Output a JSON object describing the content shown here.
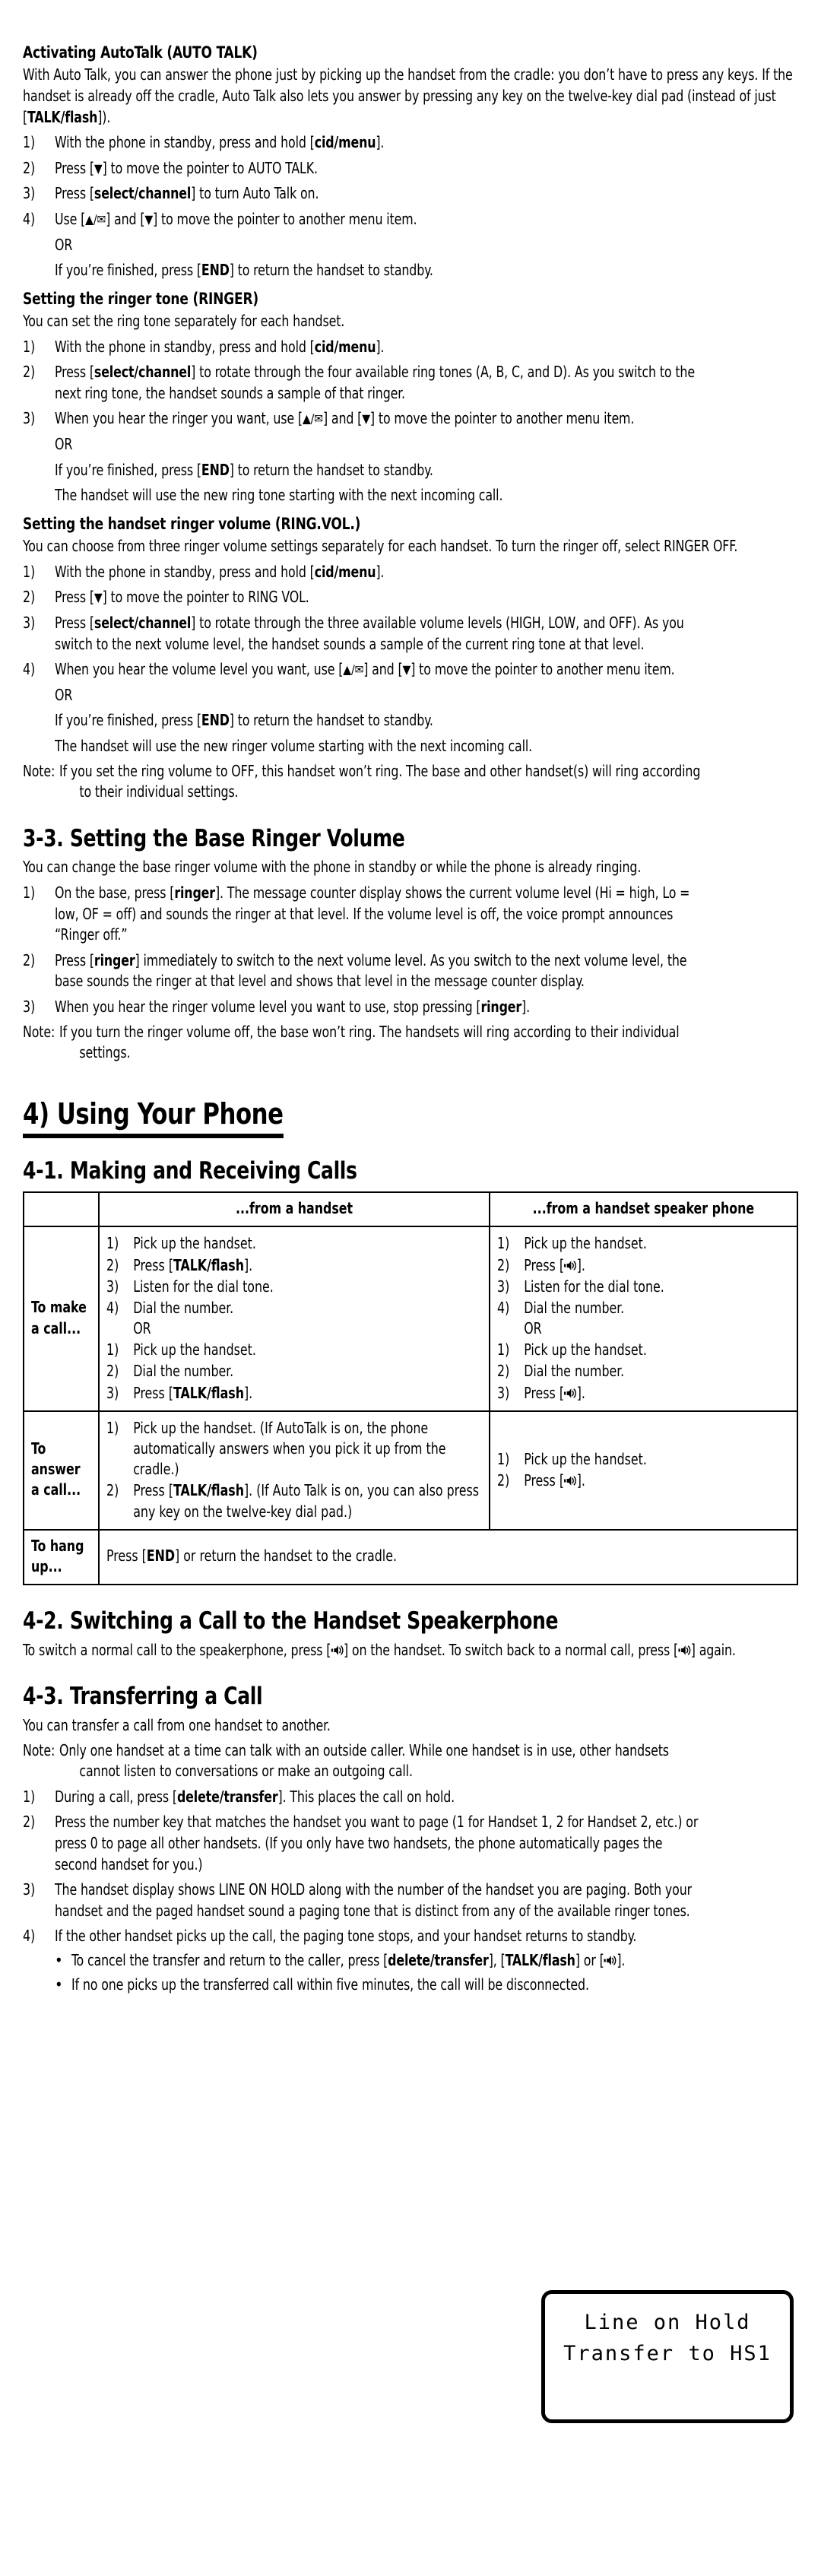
{
  "sections": [
    {
      "id": "autotalk",
      "heading": "Activating AutoTalk (AUTO TALK)",
      "intro": "With Auto Talk, you can answer the phone just by picking up the handset from the cradle: you don’t have to press any keys. If the handset is already off the cradle,  Auto Talk also lets you answer by pressing any key on the twelve-key dial pad (instead of just [TALK/flash]).",
      "steps": [
        {
          "num": "1)",
          "text": "With the phone in standby, press and hold [cid/menu]."
        },
        {
          "num": "2)",
          "text": "Press [▼] to move the pointer to AUTO TALK."
        },
        {
          "num": "3)",
          "text": "Press [select/channel] to turn Auto Talk on."
        },
        {
          "num": "4)",
          "text": "Use [▲/✉] and [▼] to move the pointer to another menu item."
        }
      ],
      "or": "OR",
      "finish": "If you’re finished, press [END] to return the handset to standby."
    },
    {
      "id": "ringer-tone",
      "heading": "Setting the ringer tone (RINGER)",
      "intro": "You can set the ring tone separately for each handset.",
      "steps": [
        {
          "num": "1)",
          "text": "With the phone in standby, press and hold [cid/menu]."
        },
        {
          "num": "2)",
          "text": "Press [select/channel] to rotate through the four available ring tones (A, B, C, and D). As you switch to the next ring tone, the handset sounds a sample of that ringer."
        },
        {
          "num": "3)",
          "text": "When you hear the ringer you want, use [▲/✉] and [▼] to move the pointer to another menu item."
        }
      ],
      "or": "OR",
      "finish": "If you’re finished, press [END] to return the handset to standby.",
      "trailer": "The handset will use the new ring tone starting with the next incoming call."
    },
    {
      "id": "ringer-volume",
      "heading": "Setting the handset ringer volume (RING.VOL.)",
      "intro": "You can choose from three ringer volume settings separately for each handset. To turn the ringer off, select RINGER OFF.",
      "steps": [
        {
          "num": "1)",
          "text": "With the phone in standby, press and hold [cid/menu]."
        },
        {
          "num": "2)",
          "text": "Press [▼] to move the pointer to RING VOL."
        },
        {
          "num": "3)",
          "text": "Press [select/channel] to rotate through the three available volume levels (HIGH, LOW, and OFF). As you switch to the next volume level, the handset sounds a sample of the current ring tone at that level."
        },
        {
          "num": "4)",
          "text": "When you hear the volume level you want, use [▲/✉] and [▼] to move the pointer to another menu item."
        }
      ],
      "or": "OR",
      "finish": "If you’re finished, press [END] to return the handset to standby.",
      "trailer": "The handset will use the new ringer volume starting with the next incoming call.",
      "note_label": "Note:",
      "note_text": "If you set the ring volume to OFF, this handset won’t ring. The base and other handset(s) will ring according to their individual settings."
    }
  ],
  "base_ringer": {
    "heading": "3-3. Setting the Base Ringer Volume",
    "intro": "You can change the base ringer volume with the phone in standby or while the phone is already ringing.",
    "steps": [
      {
        "num": "1)",
        "text": "On the base, press [ringer]. The message counter display shows the current volume level (Hi = high, Lo = low, OF = off) and sounds the ringer at that level. If the volume level is off, the voice prompt announces “Ringer off.”"
      },
      {
        "num": "2)",
        "text": "Press [ringer] immediately to switch to the next volume level. As you switch to the next volume level, the base sounds the ringer at that level and shows that level in the message counter display."
      },
      {
        "num": "3)",
        "text": "When you hear the ringer volume level you want to use, stop pressing [ringer]."
      }
    ],
    "note_label": "Note:",
    "note_text": "If you turn the ringer volume off, the base won’t ring. The handsets will ring according to their individual settings."
  },
  "chapter": {
    "title": "4) Using Your Phone"
  },
  "making_calls": {
    "heading": "4-1. Making and Receiving Calls",
    "table": {
      "headers": [
        "",
        "...from a handset",
        "...from a handset speaker phone"
      ],
      "rows": [
        {
          "label": "To make a call...",
          "handset": {
            "group1": [
              {
                "num": "1)",
                "text": "Pick up the handset."
              },
              {
                "num": "2)",
                "text": "Press [TALK/flash]."
              },
              {
                "num": "3)",
                "text": "Listen for the dial tone."
              },
              {
                "num": "4)",
                "text": "Dial the number."
              }
            ],
            "or": "OR",
            "group2": [
              {
                "num": "1)",
                "text": "Pick up the handset."
              },
              {
                "num": "2)",
                "text": "Dial the number."
              },
              {
                "num": "3)",
                "text": "Press [TALK/flash]."
              }
            ]
          },
          "speaker": {
            "group1": [
              {
                "num": "1)",
                "text": "Pick up the handset."
              },
              {
                "num": "2)",
                "text": "Press [ 🔈 ]."
              },
              {
                "num": "3)",
                "text": "Listen for the dial tone."
              },
              {
                "num": "4)",
                "text": "Dial the number."
              }
            ],
            "or": "OR",
            "group2": [
              {
                "num": "1)",
                "text": "Pick up the handset."
              },
              {
                "num": "2)",
                "text": "Dial the number."
              },
              {
                "num": "3)",
                "text": "Press [ 🔈 ]."
              }
            ]
          }
        },
        {
          "label": "To answer a call...",
          "handset": {
            "group1": [
              {
                "num": "1)",
                "text": "Pick up the handset. (If AutoTalk is on, the phone automatically answers when you pick it up from the cradle.)"
              },
              {
                "num": "2)",
                "text": "Press [TALK/flash]. (If Auto Talk is on, you can also press any key on the twelve-key dial pad.)"
              }
            ]
          },
          "speaker": {
            "group1": [
              {
                "num": "1)",
                "text": "Pick up the handset."
              },
              {
                "num": "2)",
                "text": "Press [ 🔈 ]."
              }
            ]
          }
        }
      ],
      "hangup": {
        "label": "To hang up...",
        "text": "Press [END] or return the handset to the cradle."
      }
    }
  },
  "switching": {
    "heading": "4-2. Switching a Call to the Handset Speakerphone",
    "body": "To switch a normal call to the speakerphone, press [ 🔈 ] on the handset. To switch back to a normal call, press [ 🔈 ] again."
  },
  "transferring": {
    "heading": "4-3. Transferring a Call",
    "intro": "You can transfer a call from one handset to another.",
    "note_label": "Note:",
    "note_text": "Only one handset at a time can talk with an outside caller. While one handset is in use, other handsets cannot listen to conversations or make an outgoing call.",
    "steps": [
      {
        "num": "1)",
        "text": "During a call, press [delete/transfer]. This places the call on hold."
      },
      {
        "num": "2)",
        "text": "Press the number key that matches the handset you want to page (1 for Handset 1, 2 for Handset 2, etc.) or press 0 to page all other handsets. (If you only have two handsets, the phone automatically pages the second handset for you.)"
      },
      {
        "num": "3)",
        "text": "The handset display shows LINE ON HOLD along with the number of the handset you are paging. Both your handset and the paged handset sound a paging tone that is distinct from any of the available ringer tones."
      },
      {
        "num": "4)",
        "text": "If the other handset picks up the call, the paging tone stops, and your handset returns to standby."
      }
    ],
    "bullets": [
      "To cancel the transfer and return to the caller, press [delete/transfer], [TALK/flash] or [ 🔈 ].",
      "If no one picks up the transferred call within five minutes, the call will be disconnected."
    ]
  },
  "lcd_display": {
    "line1": "Line on Hold",
    "line2": "Transfer to HS1"
  },
  "glyphs": {
    "down": "▼",
    "up": "▲",
    "envelope": "✉",
    "speaker": "speaker-icon"
  },
  "colors": {
    "text": "#000000",
    "page": "#ffffff",
    "rule": "#000000"
  }
}
